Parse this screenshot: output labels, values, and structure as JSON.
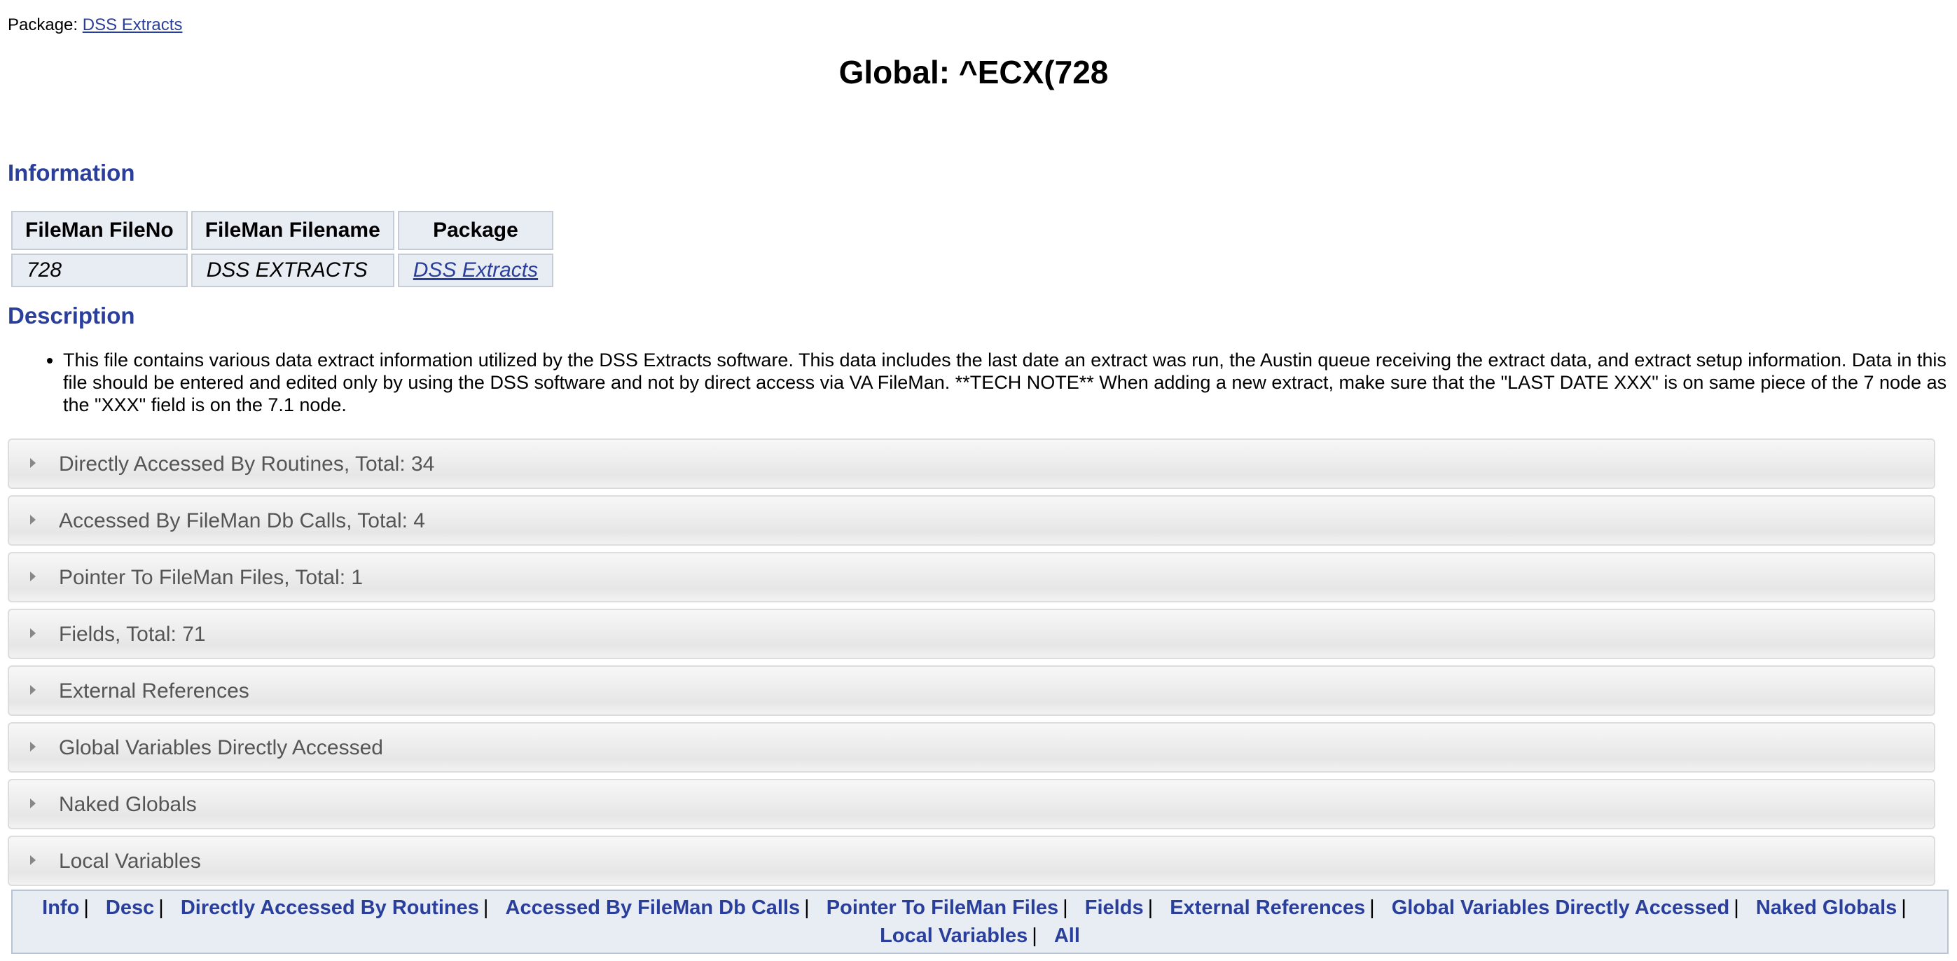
{
  "header": {
    "package_label": "Package:",
    "package_link": "DSS Extracts",
    "title": "Global: ^ECX(728"
  },
  "information": {
    "heading": "Information",
    "columns": [
      "FileMan FileNo",
      "FileMan Filename",
      "Package"
    ],
    "row": {
      "fileno": "728",
      "filename": "DSS EXTRACTS",
      "package": "DSS Extracts"
    }
  },
  "description": {
    "heading": "Description",
    "text": "This file contains various data extract information utilized by the DSS Extracts software. This data includes the last date an extract was run, the Austin queue receiving the extract data, and extract setup information. Data in this file should be entered and edited only by using the DSS software and not by direct access via VA FileMan. **TECH NOTE** When adding a new extract, make sure that the \"LAST DATE XXX\" is on same piece of the 7 node as the \"XXX\" field is on the 7.1 node."
  },
  "accordions": [
    "Directly Accessed By Routines, Total: 34",
    "Accessed By FileMan Db Calls, Total: 4",
    "Pointer To FileMan Files, Total: 1",
    "Fields, Total: 71",
    "External References",
    "Global Variables Directly Accessed",
    "Naked Globals",
    "Local Variables"
  ],
  "nav": {
    "links": [
      "Info",
      "Desc",
      "Directly Accessed By Routines",
      "Accessed By FileMan Db Calls",
      "Pointer To FileMan Files",
      "Fields",
      "External References",
      "Global Variables Directly Accessed",
      "Naked Globals",
      "Local Variables",
      "All"
    ],
    "separator": "|"
  }
}
